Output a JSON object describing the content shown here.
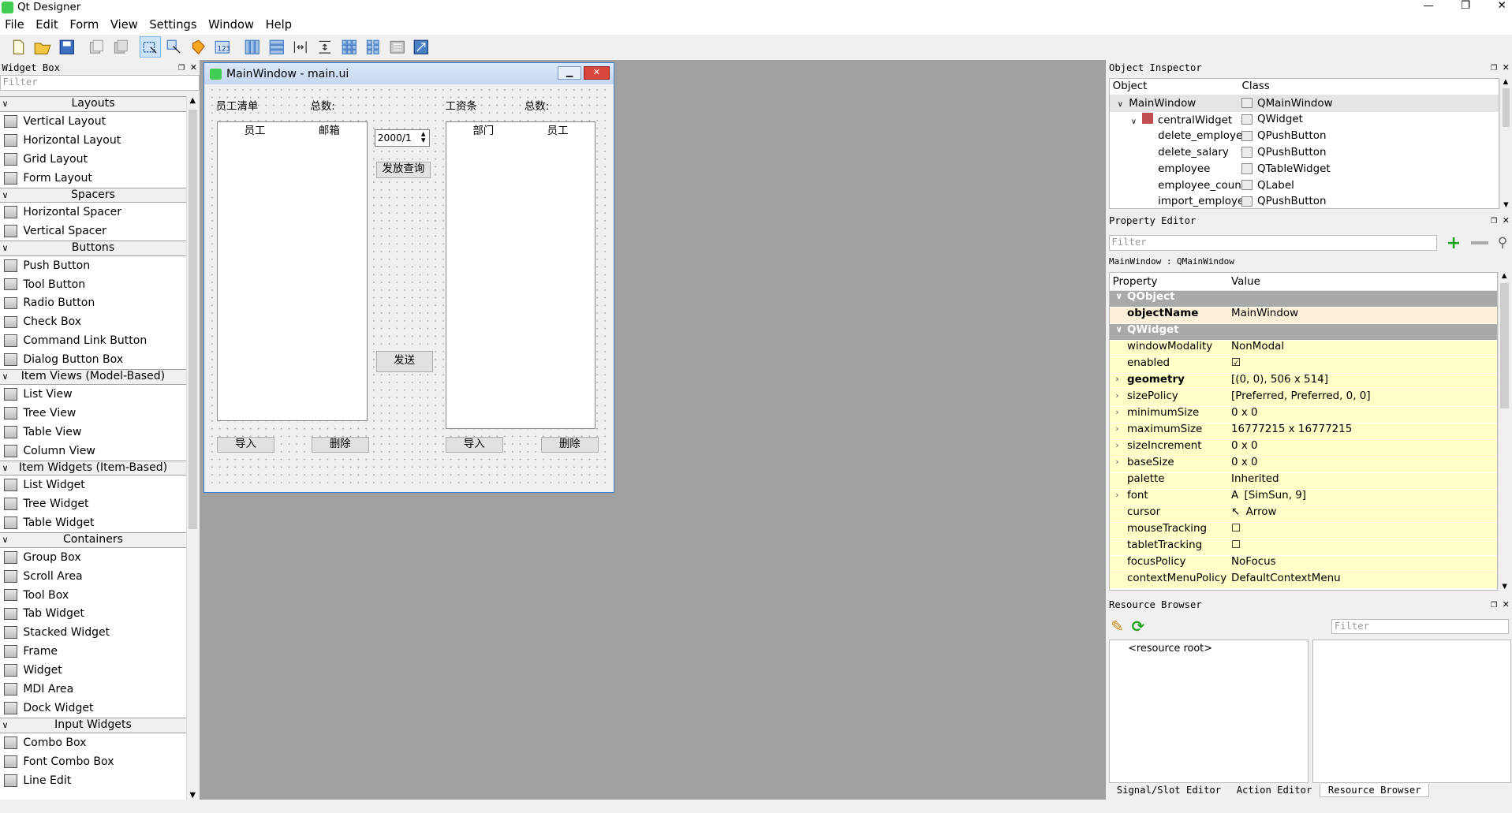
{
  "app_title": "Qt Designer",
  "window_controls": {
    "minimize": "—",
    "maximize": "❐",
    "close": "✕"
  },
  "menu": [
    "File",
    "Edit",
    "Form",
    "View",
    "Settings",
    "Window",
    "Help"
  ],
  "toolbar_icons": [
    "new-form-icon",
    "open-form-icon",
    "save-form-icon",
    "cut-icon",
    "copy-icon",
    "edit-widgets-icon",
    "edit-signals-slots-icon",
    "edit-buddies-icon",
    "edit-tab-order-icon",
    "lay-out-horizontally-icon",
    "lay-out-vertically-icon",
    "lay-out-horizontal-splitter-icon",
    "lay-out-vertical-splitter-icon",
    "lay-out-grid-icon",
    "lay-out-form-icon",
    "break-layout-icon",
    "adjust-size-icon"
  ],
  "widget_box": {
    "title": "Widget Box",
    "filter_placeholder": "Filter",
    "categories": [
      {
        "name": "Layouts",
        "items": [
          "Vertical Layout",
          "Horizontal Layout",
          "Grid Layout",
          "Form Layout"
        ]
      },
      {
        "name": "Spacers",
        "items": [
          "Horizontal Spacer",
          "Vertical Spacer"
        ]
      },
      {
        "name": "Buttons",
        "items": [
          "Push Button",
          "Tool Button",
          "Radio Button",
          "Check Box",
          "Command Link Button",
          "Dialog Button Box"
        ]
      },
      {
        "name": "Item Views (Model-Based)",
        "items": [
          "List View",
          "Tree View",
          "Table View",
          "Column View"
        ]
      },
      {
        "name": "Item Widgets (Item-Based)",
        "items": [
          "List Widget",
          "Tree Widget",
          "Table Widget"
        ]
      },
      {
        "name": "Containers",
        "items": [
          "Group Box",
          "Scroll Area",
          "Tool Box",
          "Tab Widget",
          "Stacked Widget",
          "Frame",
          "Widget",
          "MDI Area",
          "Dock Widget"
        ]
      },
      {
        "name": "Input Widgets",
        "items": [
          "Combo Box",
          "Font Combo Box",
          "Line Edit"
        ]
      }
    ]
  },
  "form": {
    "title": "MainWindow - main.ui",
    "employee_list_label": "员工清单",
    "total_label_left": "总数:",
    "salary_label": "工资条",
    "total_label_right": "总数:",
    "left_table_headers": [
      "员工",
      "邮箱"
    ],
    "right_table_headers": [
      "部门",
      "员工"
    ],
    "date_value": "2000/1",
    "issue_query_button": "发放查询",
    "send_button": "发送",
    "import_left": "导入",
    "delete_left": "删除",
    "import_right": "导入",
    "delete_right": "删除"
  },
  "object_inspector": {
    "title": "Object Inspector",
    "headers": [
      "Object",
      "Class"
    ],
    "rows": [
      {
        "object": "MainWindow",
        "class": "QMainWindow"
      },
      {
        "object": "centralWidget",
        "class": "QWidget"
      },
      {
        "object": "delete_employee",
        "class": "QPushButton"
      },
      {
        "object": "delete_salary",
        "class": "QPushButton"
      },
      {
        "object": "employee",
        "class": "QTableWidget"
      },
      {
        "object": "employee_count",
        "class": "QLabel"
      },
      {
        "object": "import_employee",
        "class": "QPushButton"
      }
    ]
  },
  "property_editor": {
    "title": "Property Editor",
    "filter_placeholder": "Filter",
    "context": "MainWindow : QMainWindow",
    "headers": [
      "Property",
      "Value"
    ],
    "groups": [
      {
        "name": "QObject",
        "props": [
          {
            "name": "objectName",
            "value": "MainWindow"
          }
        ]
      },
      {
        "name": "QWidget",
        "props": [
          {
            "name": "windowModality",
            "value": "NonModal"
          },
          {
            "name": "enabled",
            "value": "☑"
          },
          {
            "name": "geometry",
            "value": "[(0, 0), 506 x 514]"
          },
          {
            "name": "sizePolicy",
            "value": "[Preferred, Preferred, 0, 0]"
          },
          {
            "name": "minimumSize",
            "value": "0 x 0"
          },
          {
            "name": "maximumSize",
            "value": "16777215 x 16777215"
          },
          {
            "name": "sizeIncrement",
            "value": "0 x 0"
          },
          {
            "name": "baseSize",
            "value": "0 x 0"
          },
          {
            "name": "palette",
            "value": "Inherited"
          },
          {
            "name": "font",
            "value": "[SimSun, 9]"
          },
          {
            "name": "cursor",
            "value": "Arrow"
          },
          {
            "name": "mouseTracking",
            "value": "☐"
          },
          {
            "name": "tabletTracking",
            "value": "☐"
          },
          {
            "name": "focusPolicy",
            "value": "NoFocus"
          },
          {
            "name": "contextMenuPolicy",
            "value": "DefaultContextMenu"
          }
        ]
      }
    ]
  },
  "resource_browser": {
    "title": "Resource Browser",
    "filter_placeholder": "Filter",
    "root": "<resource root>"
  },
  "bottom_tabs": [
    "Signal/Slot Editor",
    "Action Editor",
    "Resource Browser"
  ]
}
